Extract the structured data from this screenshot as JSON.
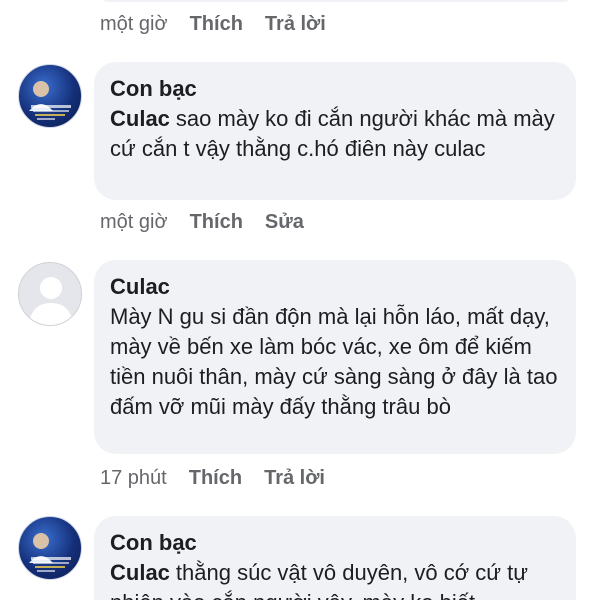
{
  "comment0": {
    "time": "một giờ",
    "like": "Thích",
    "reply": "Trả lời"
  },
  "comment1": {
    "author": "Con bạc",
    "mention": "Culac",
    "text": "sao mày ko đi cắn người khác mà mày cứ cắn t vậy thằng c.hó điên này culac",
    "time": "một giờ",
    "like": "Thích",
    "edit": "Sửa"
  },
  "comment2": {
    "author": "Culac",
    "text": "Mày N gu si đần độn mà lại hỗn láo, mất dạy, mày về bến xe làm bóc vác, xe ôm để kiếm tiền nuôi thân, mày cứ sàng sàng ở đây là tao đấm vỡ mũi mày đấy thằng trâu bò",
    "time": "17 phút",
    "like": "Thích",
    "reply": "Trả lời"
  },
  "comment3": {
    "author": "Con bạc",
    "mention": "Culac",
    "text": "thằng súc vật vô duyên, vô cớ cứ tự nhiên vào cắn người vậy, mày ko biết"
  }
}
